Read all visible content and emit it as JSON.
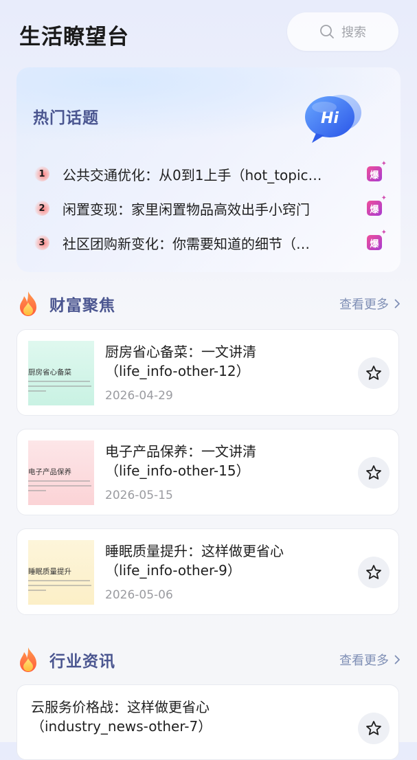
{
  "header": {
    "title": "生活瞭望台",
    "search_placeholder": "搜索"
  },
  "hot_topics": {
    "title": "热门话题",
    "badge_text": "Hi",
    "items": [
      {
        "rank": "1",
        "text": "公共交通优化：从0到1上手（hot_topic…",
        "tag": "爆"
      },
      {
        "rank": "2",
        "text": "闲置变现：家里闲置物品高效出手小窍门",
        "tag": "爆"
      },
      {
        "rank": "3",
        "text": "社区团购新变化：你需要知道的细节（…",
        "tag": "爆"
      }
    ]
  },
  "wealth_section": {
    "title": "财富聚焦",
    "more": "查看更多",
    "articles": [
      {
        "thumb_title": "厨房省心备菜",
        "title": "厨房省心备菜：一文讲清\n（life_info-other-12）",
        "date": "2026-04-29",
        "thumb_color": "#d7f5ea"
      },
      {
        "thumb_title": "电子产品保养",
        "title": "电子产品保养：一文讲清\n（life_info-other-15）",
        "date": "2026-05-15",
        "thumb_color": "#fde0e2"
      },
      {
        "thumb_title": "睡眠质量提升",
        "title": "睡眠质量提升：这样做更省心\n（life_info-other-9）",
        "date": "2026-05-06",
        "thumb_color": "#fdf3d3"
      }
    ]
  },
  "industry_section": {
    "title": "行业资讯",
    "more": "查看更多",
    "articles": [
      {
        "title": "云服务价格战：这样做更省心\n（industry_news-other-7）"
      }
    ]
  },
  "icons": {
    "search": "search-icon",
    "flame": "flame-icon",
    "star": "star-icon",
    "chevron": "chevron-right-icon"
  },
  "colors": {
    "section_title": "#4b5690",
    "hot_tag_start": "#ef4f9a",
    "hot_tag_end": "#a83bd0",
    "more_link": "#7f8fb5"
  }
}
